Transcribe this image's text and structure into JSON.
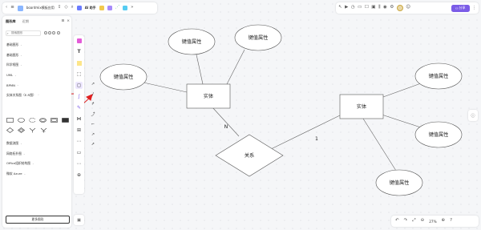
{
  "topbar": {
    "file_title": "boardmix模板应用",
    "ai_label": "AI 助手",
    "share_label": "分享"
  },
  "left_panel": {
    "tabs": [
      "图形库",
      "近期"
    ],
    "search_placeholder": "搜索图形",
    "categories": [
      "基础图形",
      "基础图形",
      "科学框图",
      "UML",
      "BPMN",
      "实体关系图（E-R图）",
      "数据流图",
      "网络拓扑图",
      "Office组织结构图",
      "微软 Azure"
    ],
    "more_button": "更多图形"
  },
  "diagram": {
    "entity1": "实体",
    "entity2": "实体",
    "relationship": "关系",
    "attributes": [
      "键值属性",
      "键值属性",
      "键值属性",
      "键值属性",
      "键值属性",
      "键值属性"
    ],
    "cardinality_n": "N",
    "cardinality_1": "1"
  },
  "zoom": {
    "value": "27%"
  },
  "colors": {
    "accent": "#7b5ce7",
    "arrow_red": "#e02020",
    "canvas": "#f5f6f8"
  }
}
